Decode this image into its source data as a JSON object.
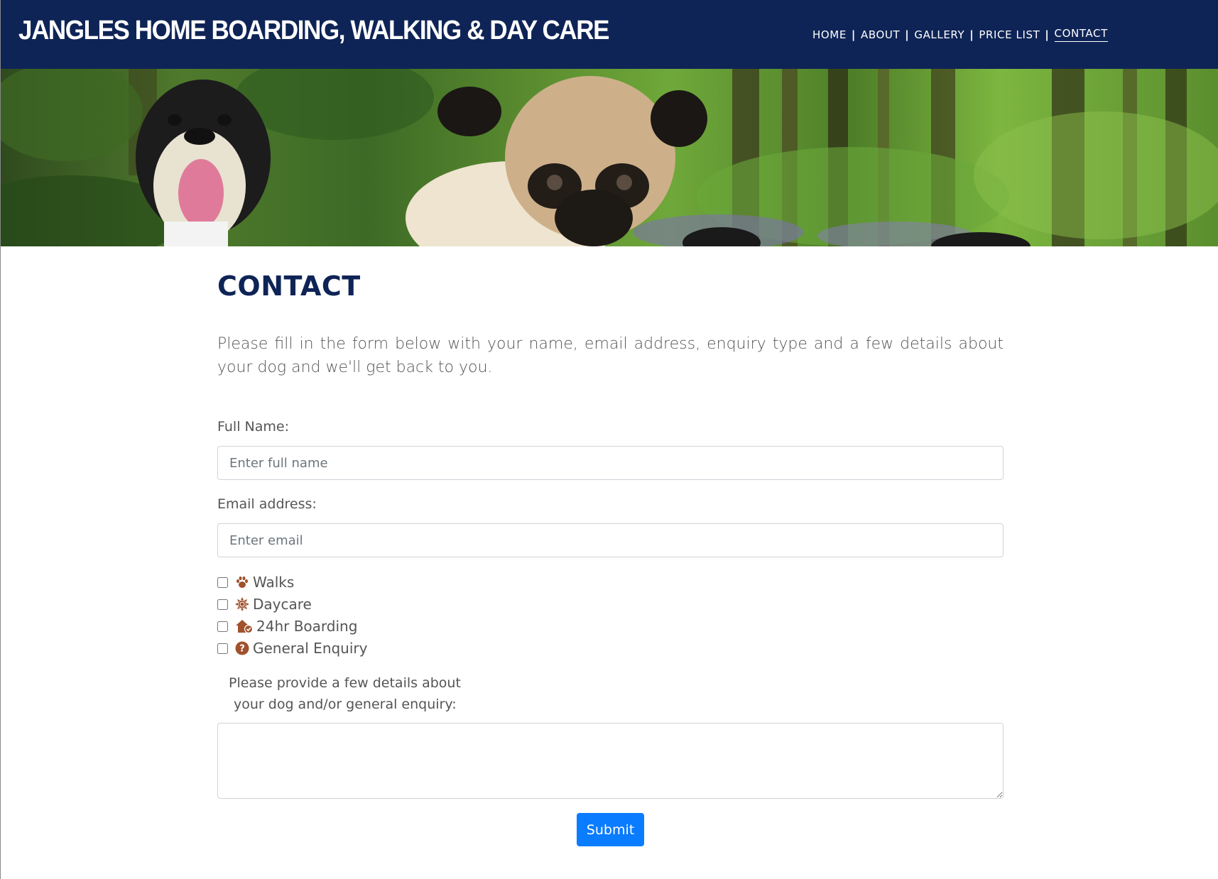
{
  "header": {
    "brand": "JANGLES HOME BOARDING, WALKING & DAY CARE",
    "nav": [
      {
        "label": "HOME"
      },
      {
        "label": "ABOUT"
      },
      {
        "label": "GALLERY"
      },
      {
        "label": "PRICE LIST"
      },
      {
        "label": "CONTACT",
        "active": true
      }
    ],
    "separator": "|",
    "colors": {
      "background": "#0f2456",
      "text": "#ffffff"
    }
  },
  "hero": {
    "icon": "dogs-in-woodland-photo"
  },
  "main": {
    "title": "CONTACT",
    "intro": "Please fill in the form below with your name, email address, enquiry type and a few details about your dog and we'll get back to you.",
    "form": {
      "name_label": "Full Name:",
      "name_placeholder": "Enter full name",
      "email_label": "Email address:",
      "email_placeholder": "Enter email",
      "options": [
        {
          "label": "Walks",
          "icon": "paw-icon",
          "checked": false
        },
        {
          "label": "Daycare",
          "icon": "sun-icon",
          "checked": false
        },
        {
          "label": "24hr Boarding",
          "icon": "house-check-icon",
          "checked": false
        },
        {
          "label": "General Enquiry",
          "icon": "question-circle-icon",
          "checked": false
        }
      ],
      "details_label_line1": "Please provide a few details about",
      "details_label_line2": "your dog and/or general enquiry:",
      "submit_label": "Submit"
    },
    "colors": {
      "title": "#0f2456",
      "icon": "#a0522d",
      "button": "#0a7cff"
    }
  }
}
